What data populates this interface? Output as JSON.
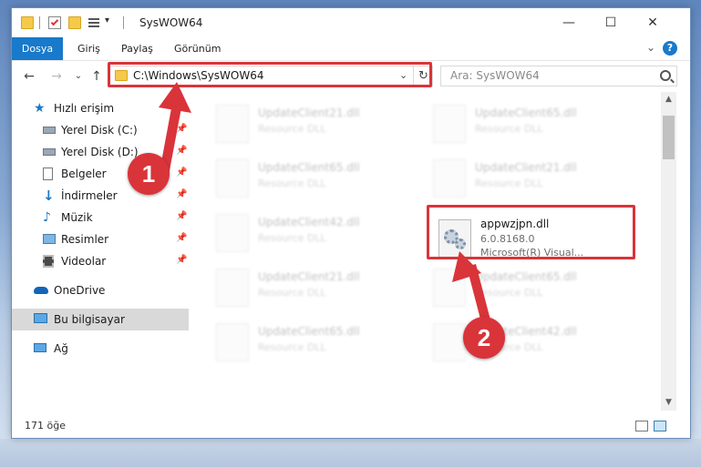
{
  "window": {
    "title": "SysWOW64",
    "controls": {
      "minimize": "—",
      "maximize": "☐",
      "close": "✕"
    }
  },
  "ribbon": {
    "tabs": [
      {
        "label": "Dosya"
      },
      {
        "label": "Giriş"
      },
      {
        "label": "Paylaş"
      },
      {
        "label": "Görünüm"
      }
    ],
    "help": "?"
  },
  "address_bar": {
    "path": "C:\\Windows\\SysWOW64",
    "search_placeholder": "Ara: SysWOW64"
  },
  "sidebar": {
    "items": [
      {
        "label": "Hızlı erişim",
        "icon": "star-icon",
        "pinned": false
      },
      {
        "label": "Yerel Disk (C:)",
        "icon": "drive-icon",
        "pinned": true
      },
      {
        "label": "Yerel Disk (D:)",
        "icon": "drive-icon",
        "pinned": true
      },
      {
        "label": "Belgeler",
        "icon": "documents-icon",
        "pinned": true
      },
      {
        "label": "İndirmeler",
        "icon": "download-icon",
        "pinned": true
      },
      {
        "label": "Müzik",
        "icon": "music-icon",
        "pinned": true
      },
      {
        "label": "Resimler",
        "icon": "pictures-icon",
        "pinned": true
      },
      {
        "label": "Videolar",
        "icon": "video-icon",
        "pinned": true
      },
      {
        "label": "OneDrive",
        "icon": "cloud-icon",
        "pinned": false
      },
      {
        "label": "Bu bilgisayar",
        "icon": "computer-icon",
        "pinned": false,
        "selected": true
      },
      {
        "label": "Ağ",
        "icon": "network-icon",
        "pinned": false
      }
    ]
  },
  "files": {
    "ghost_left": [
      {
        "name": "UpdateClient21.dll",
        "desc": "Resource DLL"
      },
      {
        "name": "UpdateClient65.dll",
        "desc": "Resource DLL"
      },
      {
        "name": "UpdateClient42.dll",
        "desc": "Resource DLL"
      },
      {
        "name": "UpdateClient21.dll",
        "desc": "Resource DLL"
      },
      {
        "name": "UpdateClient65.dll",
        "desc": "Resource DLL"
      }
    ],
    "ghost_right": [
      {
        "name": "UpdateClient65.dll",
        "desc": "Resource DLL"
      },
      {
        "name": "UpdateClient21.dll",
        "desc": "Resource DLL"
      },
      {
        "name": "UpdateClient65.dll",
        "desc": "Resource DLL"
      },
      {
        "name": "UpdateClient42.dll",
        "desc": "Resource DLL"
      }
    ],
    "highlighted": {
      "name": "appwzjpn.dll",
      "version": "6.0.8168.0",
      "company": "Microsoft(R) Visual..."
    }
  },
  "status": {
    "item_count": "171 öğe"
  },
  "annotations": {
    "step1": "1",
    "step2": "2",
    "color": "#d9343a"
  }
}
